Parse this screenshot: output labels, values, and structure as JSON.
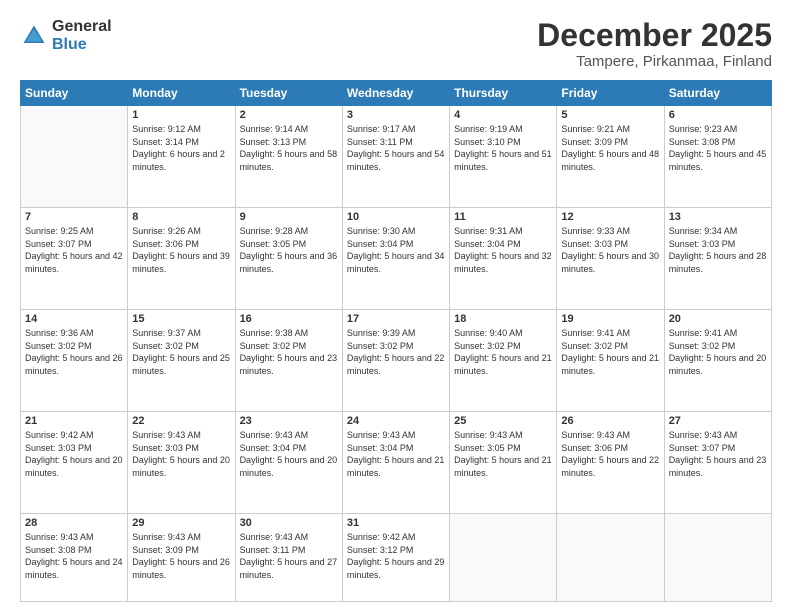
{
  "logo": {
    "general": "General",
    "blue": "Blue"
  },
  "title": {
    "month": "December 2025",
    "location": "Tampere, Pirkanmaa, Finland"
  },
  "header": {
    "days": [
      "Sunday",
      "Monday",
      "Tuesday",
      "Wednesday",
      "Thursday",
      "Friday",
      "Saturday"
    ]
  },
  "weeks": [
    [
      {
        "day": "",
        "empty": true
      },
      {
        "day": "1",
        "sunrise": "Sunrise: 9:12 AM",
        "sunset": "Sunset: 3:14 PM",
        "daylight": "Daylight: 6 hours and 2 minutes."
      },
      {
        "day": "2",
        "sunrise": "Sunrise: 9:14 AM",
        "sunset": "Sunset: 3:13 PM",
        "daylight": "Daylight: 5 hours and 58 minutes."
      },
      {
        "day": "3",
        "sunrise": "Sunrise: 9:17 AM",
        "sunset": "Sunset: 3:11 PM",
        "daylight": "Daylight: 5 hours and 54 minutes."
      },
      {
        "day": "4",
        "sunrise": "Sunrise: 9:19 AM",
        "sunset": "Sunset: 3:10 PM",
        "daylight": "Daylight: 5 hours and 51 minutes."
      },
      {
        "day": "5",
        "sunrise": "Sunrise: 9:21 AM",
        "sunset": "Sunset: 3:09 PM",
        "daylight": "Daylight: 5 hours and 48 minutes."
      },
      {
        "day": "6",
        "sunrise": "Sunrise: 9:23 AM",
        "sunset": "Sunset: 3:08 PM",
        "daylight": "Daylight: 5 hours and 45 minutes."
      }
    ],
    [
      {
        "day": "7",
        "sunrise": "Sunrise: 9:25 AM",
        "sunset": "Sunset: 3:07 PM",
        "daylight": "Daylight: 5 hours and 42 minutes."
      },
      {
        "day": "8",
        "sunrise": "Sunrise: 9:26 AM",
        "sunset": "Sunset: 3:06 PM",
        "daylight": "Daylight: 5 hours and 39 minutes."
      },
      {
        "day": "9",
        "sunrise": "Sunrise: 9:28 AM",
        "sunset": "Sunset: 3:05 PM",
        "daylight": "Daylight: 5 hours and 36 minutes."
      },
      {
        "day": "10",
        "sunrise": "Sunrise: 9:30 AM",
        "sunset": "Sunset: 3:04 PM",
        "daylight": "Daylight: 5 hours and 34 minutes."
      },
      {
        "day": "11",
        "sunrise": "Sunrise: 9:31 AM",
        "sunset": "Sunset: 3:04 PM",
        "daylight": "Daylight: 5 hours and 32 minutes."
      },
      {
        "day": "12",
        "sunrise": "Sunrise: 9:33 AM",
        "sunset": "Sunset: 3:03 PM",
        "daylight": "Daylight: 5 hours and 30 minutes."
      },
      {
        "day": "13",
        "sunrise": "Sunrise: 9:34 AM",
        "sunset": "Sunset: 3:03 PM",
        "daylight": "Daylight: 5 hours and 28 minutes."
      }
    ],
    [
      {
        "day": "14",
        "sunrise": "Sunrise: 9:36 AM",
        "sunset": "Sunset: 3:02 PM",
        "daylight": "Daylight: 5 hours and 26 minutes."
      },
      {
        "day": "15",
        "sunrise": "Sunrise: 9:37 AM",
        "sunset": "Sunset: 3:02 PM",
        "daylight": "Daylight: 5 hours and 25 minutes."
      },
      {
        "day": "16",
        "sunrise": "Sunrise: 9:38 AM",
        "sunset": "Sunset: 3:02 PM",
        "daylight": "Daylight: 5 hours and 23 minutes."
      },
      {
        "day": "17",
        "sunrise": "Sunrise: 9:39 AM",
        "sunset": "Sunset: 3:02 PM",
        "daylight": "Daylight: 5 hours and 22 minutes."
      },
      {
        "day": "18",
        "sunrise": "Sunrise: 9:40 AM",
        "sunset": "Sunset: 3:02 PM",
        "daylight": "Daylight: 5 hours and 21 minutes."
      },
      {
        "day": "19",
        "sunrise": "Sunrise: 9:41 AM",
        "sunset": "Sunset: 3:02 PM",
        "daylight": "Daylight: 5 hours and 21 minutes."
      },
      {
        "day": "20",
        "sunrise": "Sunrise: 9:41 AM",
        "sunset": "Sunset: 3:02 PM",
        "daylight": "Daylight: 5 hours and 20 minutes."
      }
    ],
    [
      {
        "day": "21",
        "sunrise": "Sunrise: 9:42 AM",
        "sunset": "Sunset: 3:03 PM",
        "daylight": "Daylight: 5 hours and 20 minutes."
      },
      {
        "day": "22",
        "sunrise": "Sunrise: 9:43 AM",
        "sunset": "Sunset: 3:03 PM",
        "daylight": "Daylight: 5 hours and 20 minutes."
      },
      {
        "day": "23",
        "sunrise": "Sunrise: 9:43 AM",
        "sunset": "Sunset: 3:04 PM",
        "daylight": "Daylight: 5 hours and 20 minutes."
      },
      {
        "day": "24",
        "sunrise": "Sunrise: 9:43 AM",
        "sunset": "Sunset: 3:04 PM",
        "daylight": "Daylight: 5 hours and 21 minutes."
      },
      {
        "day": "25",
        "sunrise": "Sunrise: 9:43 AM",
        "sunset": "Sunset: 3:05 PM",
        "daylight": "Daylight: 5 hours and 21 minutes."
      },
      {
        "day": "26",
        "sunrise": "Sunrise: 9:43 AM",
        "sunset": "Sunset: 3:06 PM",
        "daylight": "Daylight: 5 hours and 22 minutes."
      },
      {
        "day": "27",
        "sunrise": "Sunrise: 9:43 AM",
        "sunset": "Sunset: 3:07 PM",
        "daylight": "Daylight: 5 hours and 23 minutes."
      }
    ],
    [
      {
        "day": "28",
        "sunrise": "Sunrise: 9:43 AM",
        "sunset": "Sunset: 3:08 PM",
        "daylight": "Daylight: 5 hours and 24 minutes."
      },
      {
        "day": "29",
        "sunrise": "Sunrise: 9:43 AM",
        "sunset": "Sunset: 3:09 PM",
        "daylight": "Daylight: 5 hours and 26 minutes."
      },
      {
        "day": "30",
        "sunrise": "Sunrise: 9:43 AM",
        "sunset": "Sunset: 3:11 PM",
        "daylight": "Daylight: 5 hours and 27 minutes."
      },
      {
        "day": "31",
        "sunrise": "Sunrise: 9:42 AM",
        "sunset": "Sunset: 3:12 PM",
        "daylight": "Daylight: 5 hours and 29 minutes."
      },
      {
        "day": "",
        "empty": true
      },
      {
        "day": "",
        "empty": true
      },
      {
        "day": "",
        "empty": true
      }
    ]
  ]
}
